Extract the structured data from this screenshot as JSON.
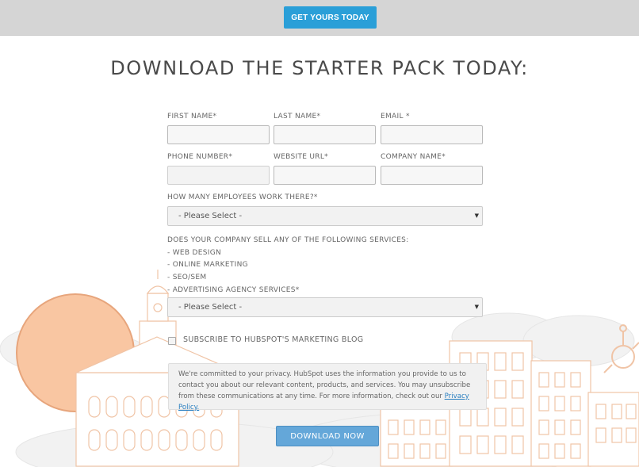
{
  "top_bar": {
    "cta_label": "GET YOURS TODAY"
  },
  "heading": "DOWNLOAD THE STARTER PACK TODAY:",
  "form": {
    "first_name_label": "FIRST NAME*",
    "last_name_label": "LAST NAME*",
    "email_label": "EMAIL *",
    "phone_label": "PHONE NUMBER*",
    "website_label": "WEBSITE URL*",
    "company_label": "COMPANY NAME*",
    "employees_label": "HOW MANY EMPLOYEES WORK THERE?*",
    "employees_select": "- Please Select -",
    "services_intro": "DOES YOUR COMPANY SELL ANY OF THE FOLLOWING SERVICES:",
    "services": [
      "- WEB DESIGN",
      "- ONLINE MARKETING",
      "- SEO/SEM",
      "- ADVERTISING AGENCY SERVICES*"
    ],
    "services_select": "- Please Select -",
    "subscribe_label": "SUBSCRIBE TO HUBSPOT'S MARKETING BLOG",
    "privacy_text": "We're committed to your privacy. HubSpot uses the information you provide to us to contact you about our relevant content, products, and services. You may unsubscribe from these communications at any time. For more information, check out our ",
    "privacy_link": "Privacy Policy.",
    "submit_label": "DOWNLOAD NOW"
  },
  "colors": {
    "top_bar_bg": "#d5d5d5",
    "cta_blue": "#2a9fd8",
    "submit_blue": "#64a7d9",
    "sun_orange": "#f9c6a2",
    "building_outline": "#f3cdb3"
  },
  "icons": [
    "select-arrow-icon",
    "checkbox-icon"
  ]
}
